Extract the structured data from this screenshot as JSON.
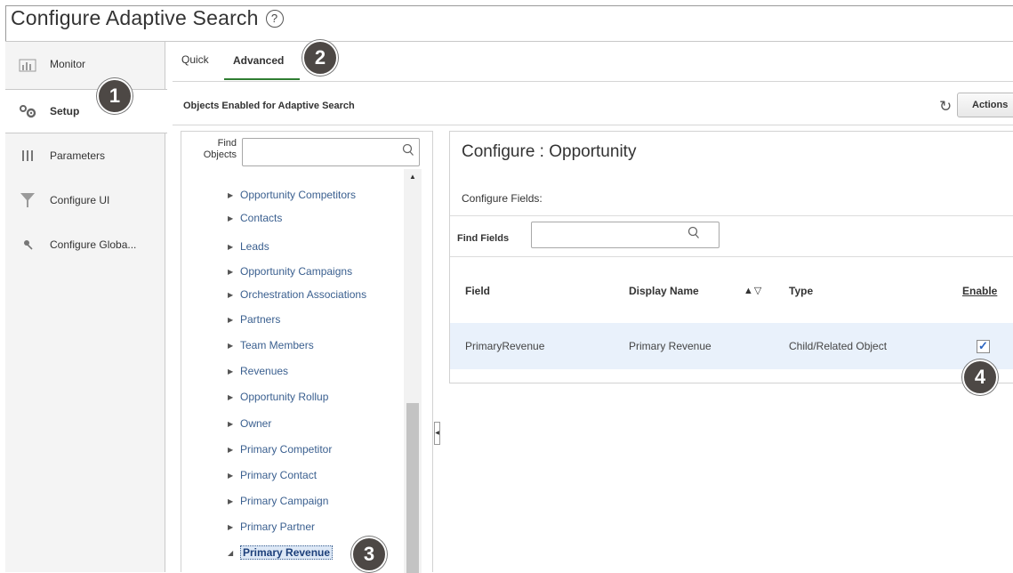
{
  "page": {
    "title": "Configure Adaptive Search"
  },
  "nav": {
    "items": [
      {
        "label": "Monitor",
        "icon": "bar-chart-icon"
      },
      {
        "label": "Setup",
        "icon": "gears-icon",
        "active": true
      },
      {
        "label": "Parameters",
        "icon": "sliders-icon"
      },
      {
        "label": "Configure UI",
        "icon": "funnel-icon"
      },
      {
        "label": "Configure Globa...",
        "icon": "pin-icon"
      }
    ]
  },
  "callouts": {
    "c1": "1",
    "c2": "2",
    "c3": "3",
    "c4": "4"
  },
  "tabs": [
    {
      "label": "Quick"
    },
    {
      "label": "Advanced",
      "active": true
    }
  ],
  "section": {
    "title": "Objects Enabled for Adaptive Search",
    "actions_label": "Actions"
  },
  "tree": {
    "find_label": "Find Objects",
    "find_value": "",
    "items": [
      {
        "label": "Opportunity Competitors"
      },
      {
        "label": "Contacts"
      },
      {
        "label": "Leads"
      },
      {
        "label": "Opportunity Campaigns"
      },
      {
        "label": "Orchestration Associations"
      },
      {
        "label": "Partners"
      },
      {
        "label": "Team Members"
      },
      {
        "label": "Revenues"
      },
      {
        "label": "Opportunity Rollup"
      },
      {
        "label": "Owner"
      },
      {
        "label": "Primary Competitor"
      },
      {
        "label": "Primary Contact"
      },
      {
        "label": "Primary Campaign"
      },
      {
        "label": "Primary Partner"
      },
      {
        "label": "Primary Revenue",
        "expanded": true,
        "selected": true
      }
    ]
  },
  "configure": {
    "title": "Configure : Opportunity",
    "subtitle": "Configure Fields:",
    "find_fields_label": "Find Fields",
    "find_fields_value": "",
    "columns": {
      "field": "Field",
      "display_name": "Display Name",
      "type": "Type",
      "enable": "Enable"
    },
    "rows": [
      {
        "field": "PrimaryRevenue",
        "display_name": "Primary Revenue",
        "type": "Child/Related Object",
        "enabled": true
      }
    ]
  },
  "colors": {
    "callout_bg": "#4d4845",
    "tab_underline": "#2f7d32",
    "selected_row": "#e9f1fb",
    "link": "#3a5f8f"
  }
}
